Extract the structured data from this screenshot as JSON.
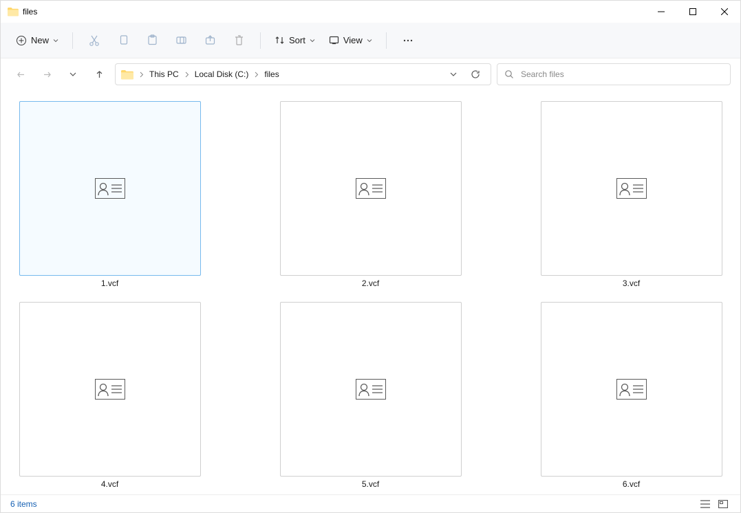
{
  "window": {
    "title": "files"
  },
  "toolbar": {
    "new_label": "New",
    "sort_label": "Sort",
    "view_label": "View"
  },
  "breadcrumbs": {
    "items": [
      {
        "label": "This PC"
      },
      {
        "label": "Local Disk (C:)"
      },
      {
        "label": "files"
      }
    ]
  },
  "search": {
    "placeholder": "Search files"
  },
  "files": {
    "items": [
      {
        "name": "1.vcf",
        "selected": true
      },
      {
        "name": "2.vcf",
        "selected": false
      },
      {
        "name": "3.vcf",
        "selected": false
      },
      {
        "name": "4.vcf",
        "selected": false
      },
      {
        "name": "5.vcf",
        "selected": false
      },
      {
        "name": "6.vcf",
        "selected": false
      }
    ]
  },
  "status": {
    "text": "6 items"
  }
}
